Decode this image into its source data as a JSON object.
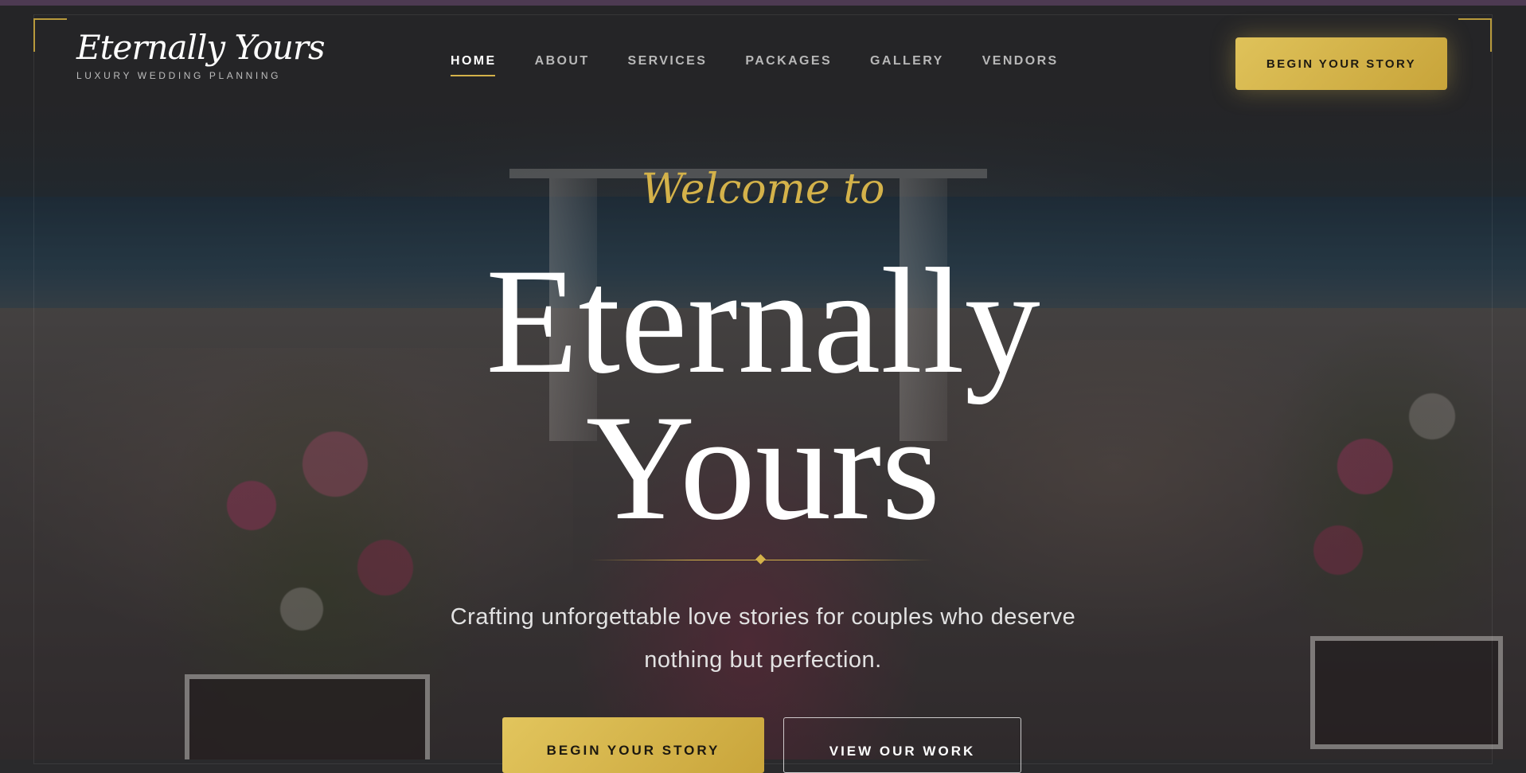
{
  "colors": {
    "accent_gold": "#d4b24a",
    "overlay": "#2a2a2c",
    "top_stripe": "#4d3a52"
  },
  "header": {
    "logo_title": "Eternally Yours",
    "logo_subtitle": "LUXURY WEDDING PLANNING",
    "nav": [
      {
        "label": "HOME",
        "active": true
      },
      {
        "label": "ABOUT",
        "active": false
      },
      {
        "label": "SERVICES",
        "active": false
      },
      {
        "label": "PACKAGES",
        "active": false
      },
      {
        "label": "GALLERY",
        "active": false
      },
      {
        "label": "VENDORS",
        "active": false
      }
    ],
    "cta_label": "BEGIN YOUR STORY"
  },
  "hero": {
    "welcome": "Welcome to",
    "title_line1": "Eternally",
    "title_line2": "Yours",
    "tagline_line1": "Crafting unforgettable love stories for couples who deserve",
    "tagline_line2": "nothing but perfection.",
    "primary_button": "BEGIN YOUR STORY",
    "secondary_button": "VIEW OUR WORK"
  }
}
